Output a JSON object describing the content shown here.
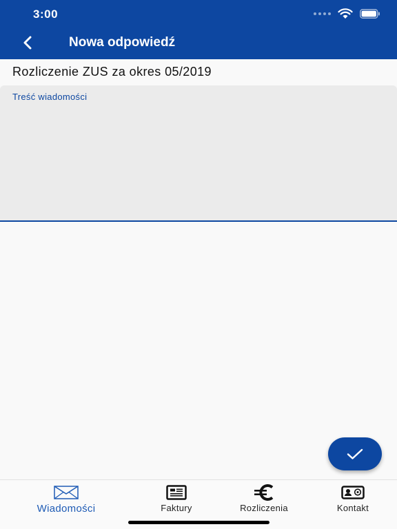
{
  "status_bar": {
    "time": "3:00"
  },
  "nav": {
    "title": "Nowa odpowiedź",
    "back_icon": "chevron-left-icon"
  },
  "subject": "Rozliczenie ZUS za okres 05/2019",
  "message": {
    "label": "Treść wiadomości",
    "value": ""
  },
  "fab": {
    "icon": "checkmark-icon"
  },
  "tabs": [
    {
      "label": "Wiadomości",
      "icon": "envelope-icon",
      "active": true
    },
    {
      "label": "Faktury",
      "icon": "invoice-icon",
      "active": false
    },
    {
      "label": "Rozliczenia",
      "icon": "euro-icon",
      "active": false
    },
    {
      "label": "Kontakt",
      "icon": "contact-card-icon",
      "active": false
    }
  ],
  "colors": {
    "primary": "#0d47a1",
    "active_tab": "#1e5bb5",
    "field_background": "#ebebeb",
    "page_background": "#f9f9f9"
  }
}
